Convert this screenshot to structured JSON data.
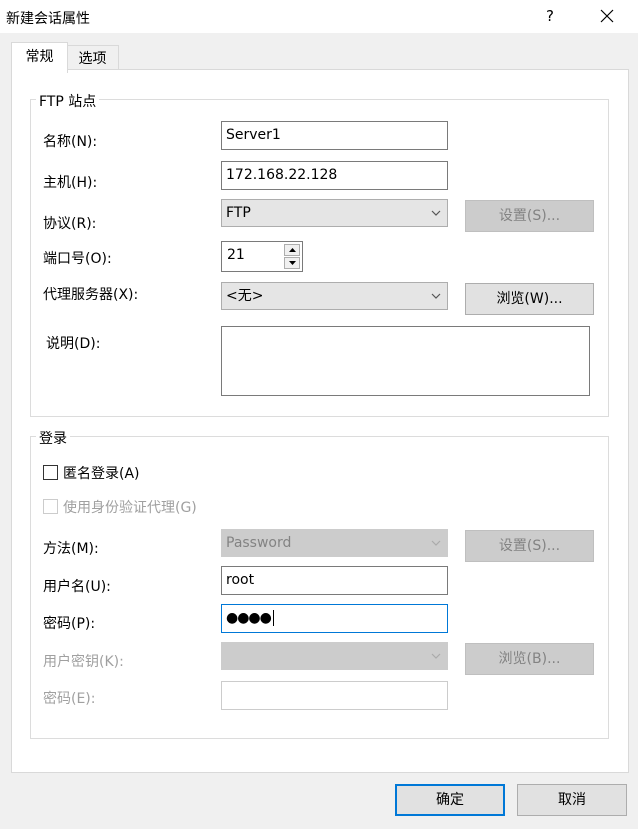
{
  "window": {
    "title": "新建会话属性",
    "help_label": "?",
    "close_icon": "close-icon"
  },
  "tabs": [
    {
      "label": "常规",
      "active": true
    },
    {
      "label": "选项",
      "active": false
    }
  ],
  "ftp_site": {
    "group_title": "FTP 站点",
    "name_label": "名称(N):",
    "name_value": "Server1",
    "host_label": "主机(H):",
    "host_value": "172.168.22.128",
    "protocol_label": "协议(R):",
    "protocol_value": "FTP",
    "protocol_settings_button": "设置(S)...",
    "port_label": "端口号(O):",
    "port_value": "21",
    "proxy_label": "代理服务器(X):",
    "proxy_value": "<无>",
    "proxy_browse_button": "浏览(W)...",
    "description_label": "说明(D):",
    "description_value": ""
  },
  "login": {
    "group_title": "登录",
    "anonymous_label": "匿名登录(A)",
    "anonymous_checked": false,
    "auth_proxy_label": "使用身份验证代理(G)",
    "auth_proxy_checked": false,
    "method_label": "方法(M):",
    "method_value": "Password",
    "method_settings_button": "设置(S)...",
    "username_label": "用户名(U):",
    "username_value": "root",
    "password_label": "密码(P):",
    "password_value": "●●●●",
    "user_key_label": "用户密钥(K):",
    "user_key_value": "",
    "user_key_browse_button": "浏览(B)...",
    "passphrase_label": "密码(E):",
    "passphrase_value": ""
  },
  "footer": {
    "ok_button": "确定",
    "cancel_button": "取消"
  },
  "colors": {
    "focus_border": "#0078d7",
    "window_bg": "#f0f0f0",
    "disabled_text": "#a0a0a0"
  }
}
